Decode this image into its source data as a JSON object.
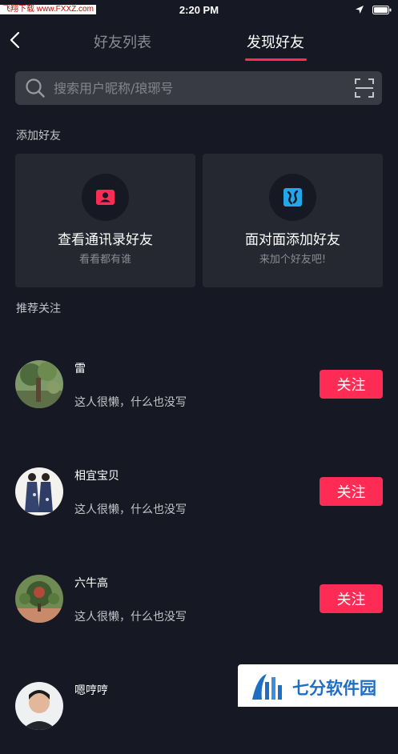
{
  "status_bar": {
    "watermark": "飞翔下载 www.FXXZ.com",
    "time": "2:20 PM"
  },
  "header": {
    "tabs": [
      {
        "label": "好友列表",
        "active": false
      },
      {
        "label": "发现好友",
        "active": true
      }
    ]
  },
  "search": {
    "placeholder": "搜索用户昵称/琅琊号"
  },
  "add_friends": {
    "title": "添加好友",
    "cards": [
      {
        "title": "查看通讯录好友",
        "subtitle": "看看都有谁",
        "icon": "contacts-icon"
      },
      {
        "title": "面对面添加好友",
        "subtitle": "来加个好友吧!",
        "icon": "face-to-face-icon"
      }
    ]
  },
  "recommend": {
    "title": "推荐关注",
    "users": [
      {
        "name": "雷",
        "bio": "这人很懒，什么也没写",
        "button": "关注"
      },
      {
        "name": "相宜宝贝",
        "bio": "这人很懒，什么也没写",
        "button": "关注"
      },
      {
        "name": "六牛高",
        "bio": "这人很懒，什么也没写",
        "button": "关注"
      },
      {
        "name": "嗯哼哼",
        "bio": "",
        "button": ""
      }
    ]
  },
  "brand_badge": {
    "text": "七分软件园"
  },
  "colors": {
    "background": "#161823",
    "card": "#252731",
    "search": "#393b44",
    "accent": "#fe2c55"
  }
}
